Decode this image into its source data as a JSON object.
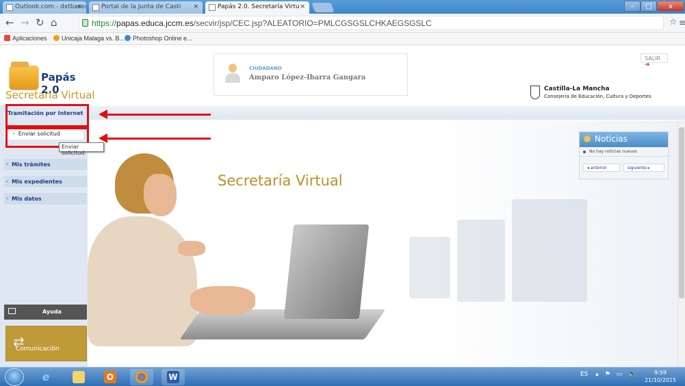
{
  "browser": {
    "tabs": [
      {
        "label": "Outlook.com - dxtbase@",
        "active": false
      },
      {
        "label": "Portal de la Junta de Casti",
        "active": false
      },
      {
        "label": "Papás 2.0. Secretaría Virtu",
        "active": true
      }
    ],
    "url_scheme": "https://",
    "url_host": "papas.educa.jccm.es",
    "url_path": "/secvir/jsp/CEC.jsp?ALEATORIO=PMLCGSGSLCHKAEGSGSLC",
    "bookmarks": [
      "Aplicaciones",
      "Unicaja Malaga vs. B...",
      "Photoshop Online e..."
    ]
  },
  "header": {
    "logo_title": "Papás 2.0",
    "logo_subtitle": "Secretaría Virtual",
    "user_role": "CIUDADANO",
    "user_name": "Amparo López-Ibarra Gangara",
    "logout_label": "SALIR",
    "org_name": "Castilla-La Mancha",
    "org_department": "Consejería de Educación, Cultura y Deportes"
  },
  "sidebar": {
    "section_label": "Tramitación por Internet",
    "submenu_item": "Enviar solicitud",
    "tooltip": "Enviar solicitud",
    "items": [
      "Mis trámites",
      "Mis expedientes",
      "Mis datos"
    ],
    "help_label": "Ayuda",
    "communication_label": "Comunicación"
  },
  "main": {
    "hero_title": "Secretaría Virtual"
  },
  "news": {
    "title": "Noticias",
    "empty_message": "No hay noticias nuevas",
    "prev_label": "◂ anterior",
    "next_label": "siguiente ▸"
  },
  "taskbar": {
    "language": "ES",
    "time": "9:59",
    "date": "21/10/2015"
  },
  "colors": {
    "accent_gold": "#c28d27",
    "nav_blue": "#1d3c7e",
    "annotation_red": "#e01010"
  }
}
